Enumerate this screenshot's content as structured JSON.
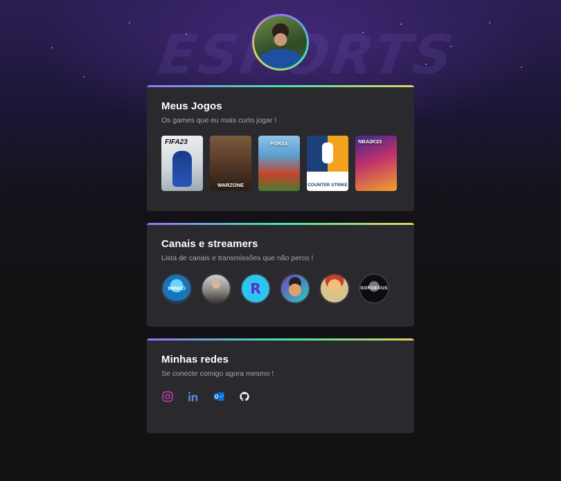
{
  "background": {
    "watermark": "ESPORTS"
  },
  "profile": {
    "avatar_alt": "profile-photo"
  },
  "cards": {
    "games": {
      "title": "Meus Jogos",
      "subtitle": "Os games que eu mais curto jogar !",
      "items": [
        {
          "name": "FIFA 23",
          "label": "FIFA23"
        },
        {
          "name": "Call of Duty Warzone",
          "label": "WARZONE"
        },
        {
          "name": "Forza Horizon 5",
          "label": "FORZA"
        },
        {
          "name": "Counter-Strike",
          "label": "COUNTER STRIKE"
        },
        {
          "name": "NBA 2K23",
          "label": "NBA2K23"
        }
      ]
    },
    "streamers": {
      "title": "Canais e streamers",
      "subtitle": "Lista de canais e transmissões que não perco !",
      "items": [
        {
          "name": "streamer-1",
          "label": "IMINHO"
        },
        {
          "name": "streamer-2",
          "label": ""
        },
        {
          "name": "streamer-3",
          "label": "R"
        },
        {
          "name": "streamer-4",
          "label": ""
        },
        {
          "name": "streamer-5",
          "label": ""
        },
        {
          "name": "streamer-6",
          "label": "GORGEOUS"
        }
      ]
    },
    "socials": {
      "title": "Minhas redes",
      "subtitle": "Se conecte comigo agora mesmo !",
      "items": [
        {
          "icon": "instagram-icon",
          "color": "#d63ab0"
        },
        {
          "icon": "linkedin-icon",
          "color": "#5b8bd4"
        },
        {
          "icon": "outlook-icon",
          "color": "#0a74d8"
        },
        {
          "icon": "github-icon",
          "color": "#ffffff"
        }
      ]
    }
  },
  "colors": {
    "card_bg": "#29292e",
    "gradient": [
      "#9572fc",
      "#43e7ad",
      "#e2d45c"
    ],
    "page_bg": "#121214"
  }
}
